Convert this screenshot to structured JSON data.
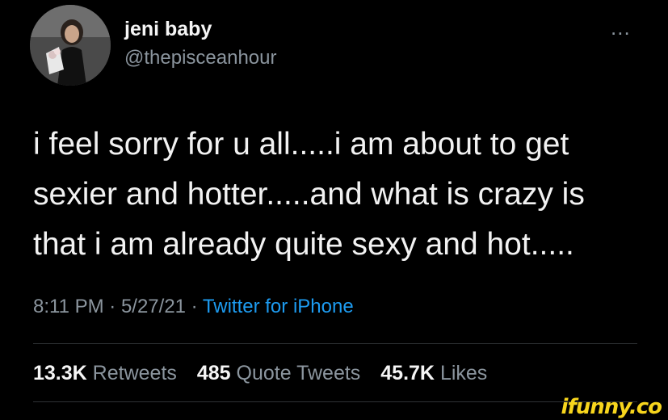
{
  "user": {
    "display_name": "jeni baby",
    "handle": "@thepisceanhour",
    "avatar": "profile-photo"
  },
  "more_menu": "...",
  "tweet": {
    "lines": [
      "i feel sorry for u all.....i am about to get",
      "sexier and hotter.....and what is crazy is",
      "that i am already quite sexy and hot....."
    ]
  },
  "meta": {
    "time": "8:11 PM",
    "separator": " · ",
    "date": "5/27/21",
    "source": "Twitter for iPhone"
  },
  "stats": {
    "retweets_count": "13.3K",
    "retweets_label": "Retweets",
    "quotes_count": "485",
    "quotes_label": "Quote Tweets",
    "likes_count": "45.7K",
    "likes_label": "Likes"
  },
  "watermark": "ifunny.co",
  "colors": {
    "background": "#000000",
    "secondary_text": "#8b959e",
    "link": "#1d9bf0",
    "watermark": "#f7d51d"
  }
}
